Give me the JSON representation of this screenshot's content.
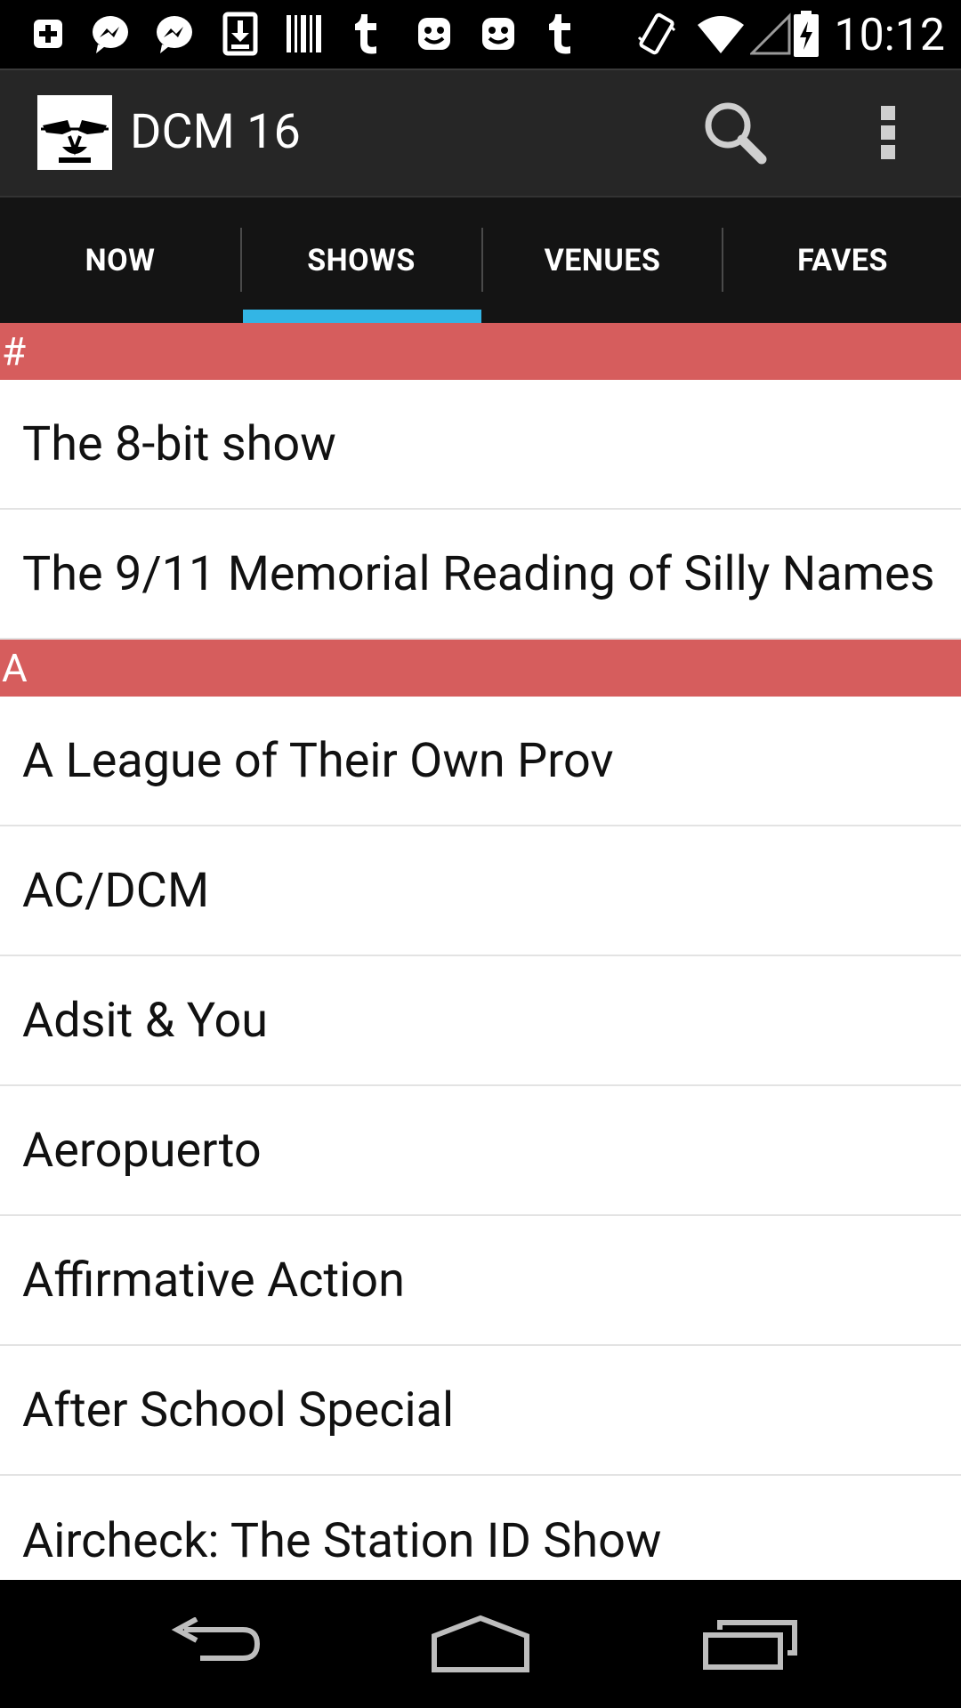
{
  "status_bar": {
    "time": "10:12",
    "notification_icons": [
      "add-icon",
      "messenger-icon",
      "messenger-icon",
      "download-icon",
      "barcode-icon",
      "tumblr-icon",
      "app-icon",
      "app-icon",
      "tumblr-icon"
    ],
    "system_icons": [
      "vibrate-icon",
      "wifi-icon",
      "signal-icon",
      "battery-charging-icon"
    ]
  },
  "action_bar": {
    "title": "DCM 16",
    "search_icon": "search-icon",
    "overflow_icon": "overflow-menu-icon"
  },
  "tabs": [
    {
      "label": "NOW",
      "selected": false
    },
    {
      "label": "SHOWS",
      "selected": true
    },
    {
      "label": "VENUES",
      "selected": false
    },
    {
      "label": "FAVES",
      "selected": false
    }
  ],
  "colors": {
    "section_header": "#d65d5d",
    "tab_indicator": "#33b5e5",
    "action_bar": "#262626",
    "tab_bar": "#141414"
  },
  "list": {
    "sections": [
      {
        "header": "#",
        "items": [
          "The 8-bit show",
          "The 9/11 Memorial Reading of Silly Names"
        ]
      },
      {
        "header": "A",
        "items": [
          "A League of Their Own Prov",
          "AC/DCM",
          "Adsit & You",
          "Aeropuerto",
          "Affirmative Action",
          "After School Special",
          "Aircheck: The Station ID Show"
        ]
      }
    ]
  },
  "nav_bar": {
    "back_icon": "back-icon",
    "home_icon": "home-icon",
    "recents_icon": "recents-icon"
  }
}
